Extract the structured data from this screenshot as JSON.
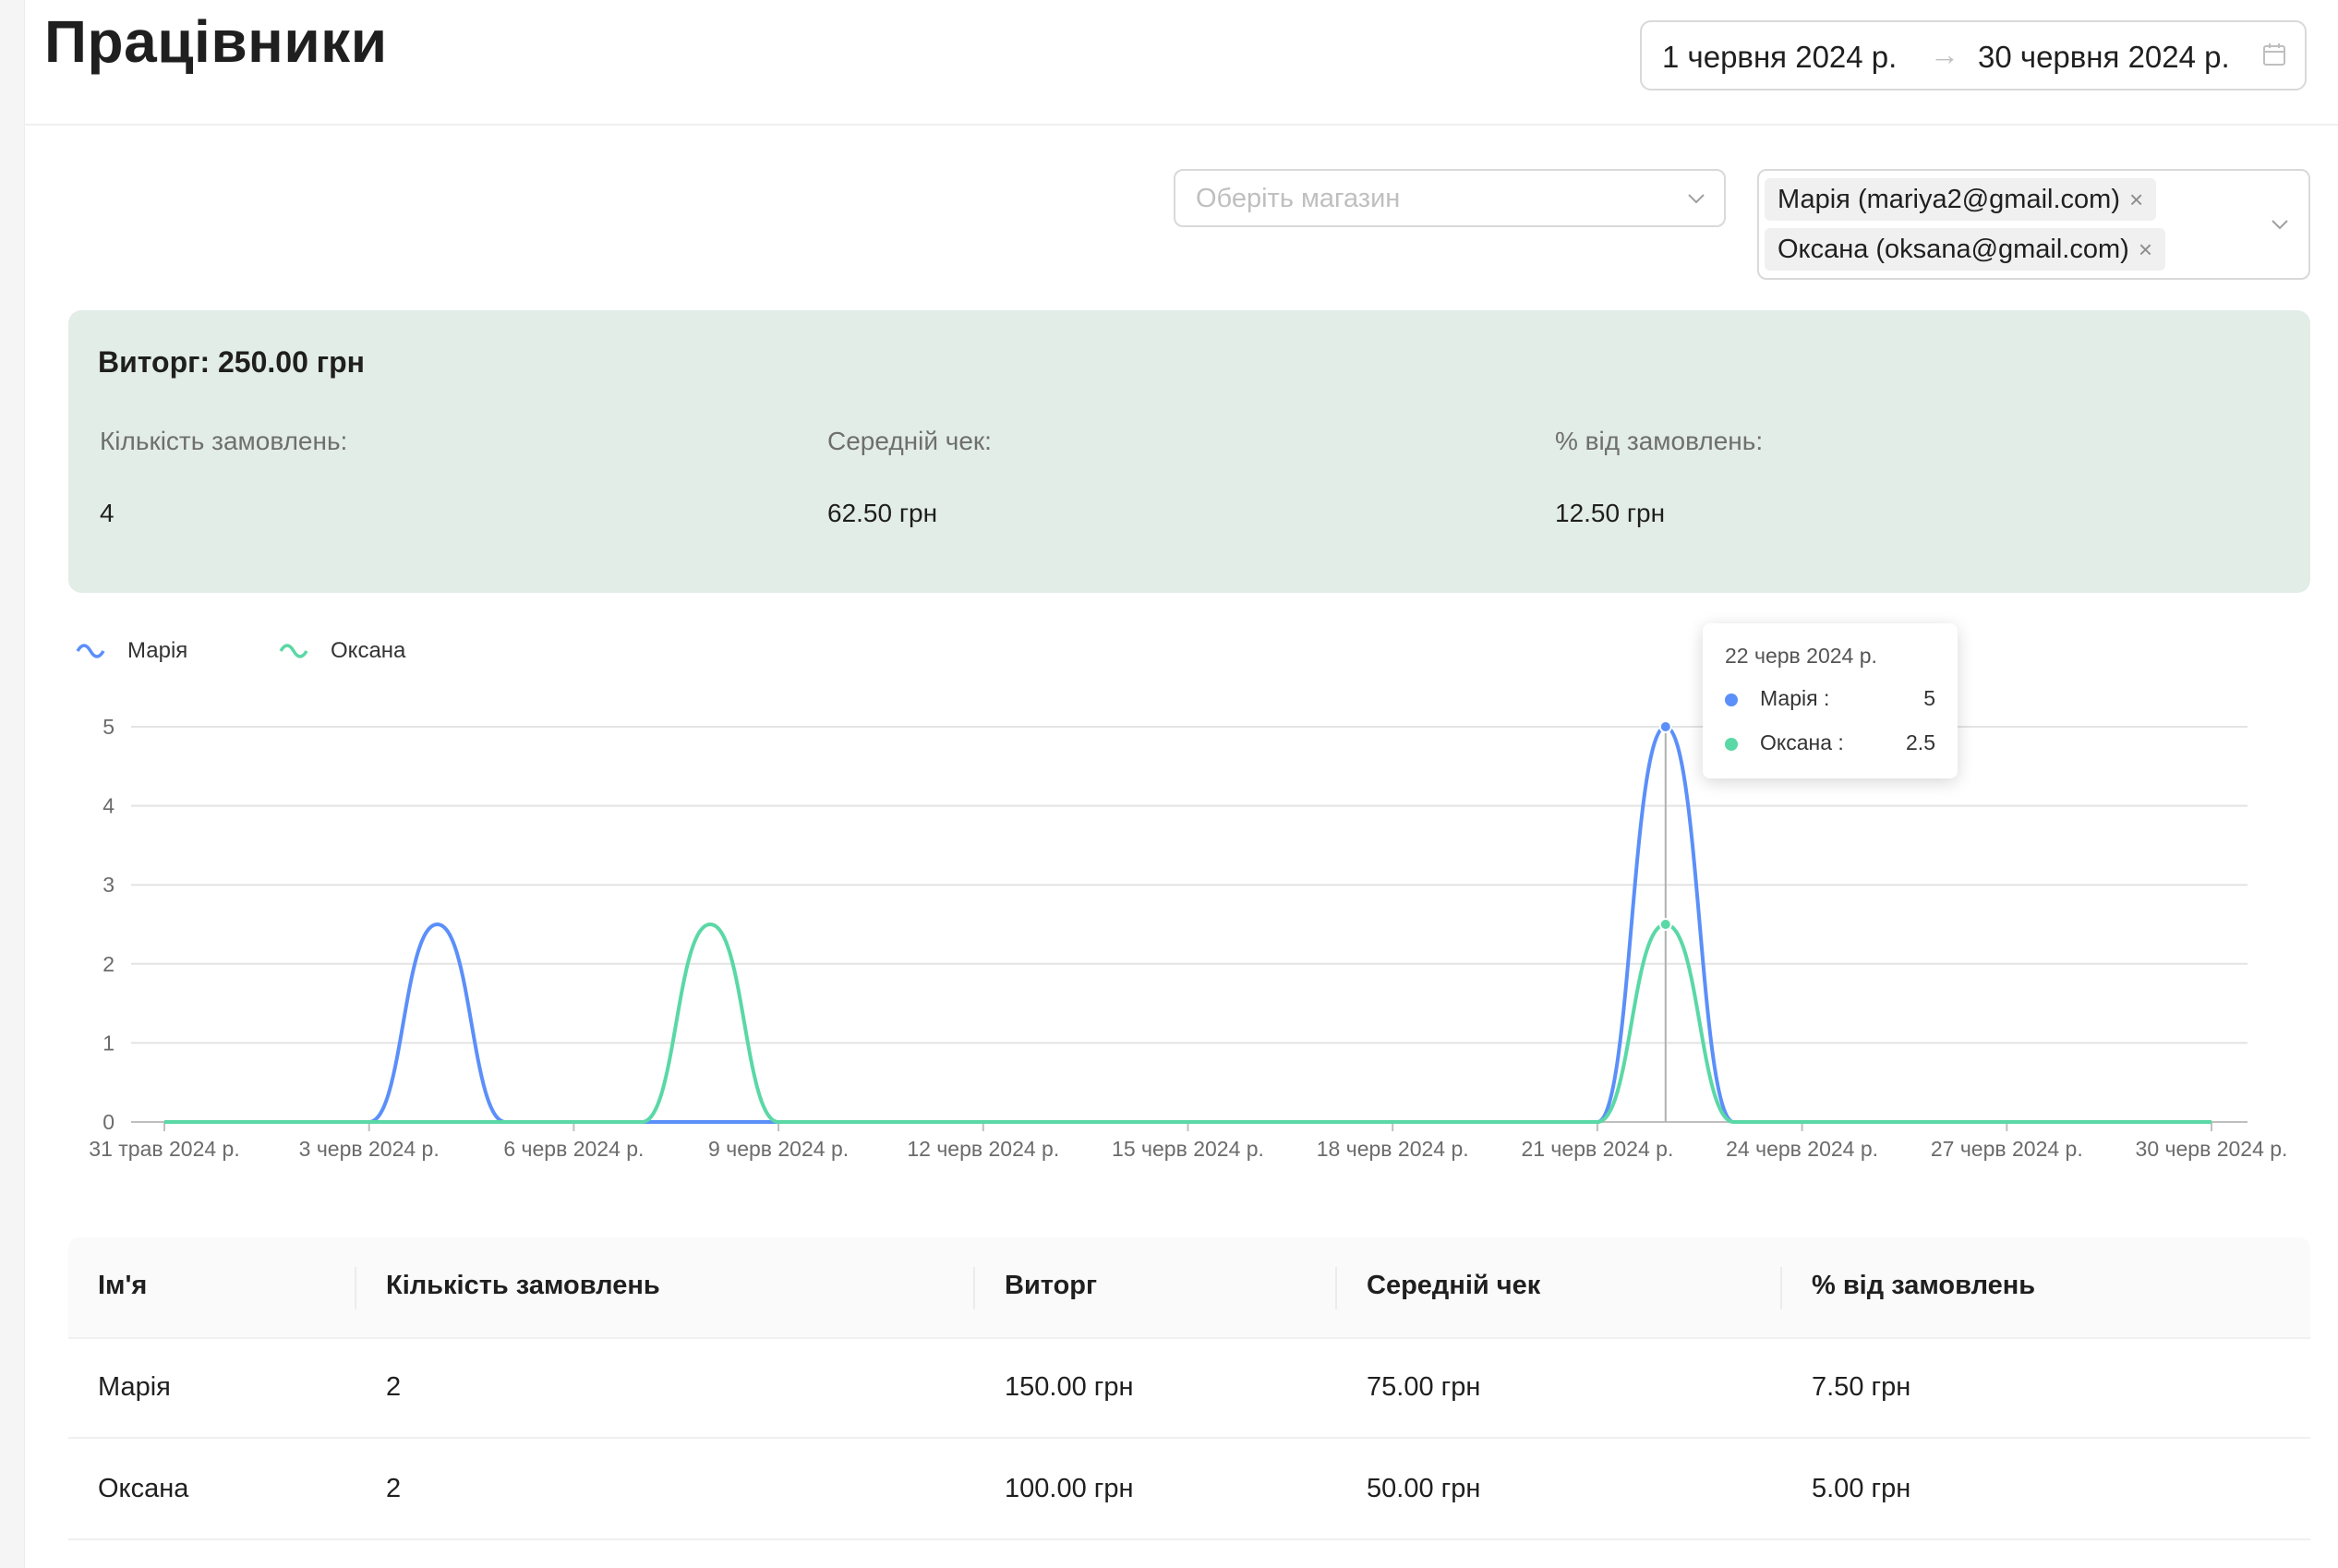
{
  "header": {
    "title": "Працівники",
    "date_range": {
      "start": "1 червня 2024 р.",
      "arrow": "→",
      "end": "30 червня 2024 р."
    }
  },
  "filters": {
    "store_placeholder": "Оберіть магазин",
    "employees": [
      {
        "label": "Марія  (mariya2@gmail.com)"
      },
      {
        "label": "Оксана  (oksana@gmail.com)"
      }
    ],
    "tag_close": "×"
  },
  "summary": {
    "title": "Виторг: 250.00 грн",
    "stats": [
      {
        "label": "Кількість замовлень:",
        "value": "4"
      },
      {
        "label": "Середній чек:",
        "value": "62.50 грн"
      },
      {
        "label": "% від замовлень:",
        "value": "12.50 грн"
      }
    ]
  },
  "colors": {
    "series_maria": "#5b8ff9",
    "series_oksana": "#5ad8a6",
    "summary_bg": "#e3ede7"
  },
  "chart_data": {
    "type": "line",
    "x_dates": [
      "2024-05-31",
      "2024-06-01",
      "2024-06-02",
      "2024-06-03",
      "2024-06-04",
      "2024-06-05",
      "2024-06-06",
      "2024-06-07",
      "2024-06-08",
      "2024-06-09",
      "2024-06-10",
      "2024-06-11",
      "2024-06-12",
      "2024-06-13",
      "2024-06-14",
      "2024-06-15",
      "2024-06-16",
      "2024-06-17",
      "2024-06-18",
      "2024-06-19",
      "2024-06-20",
      "2024-06-21",
      "2024-06-22",
      "2024-06-23",
      "2024-06-24",
      "2024-06-25",
      "2024-06-26",
      "2024-06-27",
      "2024-06-28",
      "2024-06-29",
      "2024-06-30"
    ],
    "x_ticks": [
      "31 трав 2024 р.",
      "3 черв 2024 р.",
      "6 черв 2024 р.",
      "9 черв 2024 р.",
      "12 черв 2024 р.",
      "15 черв 2024 р.",
      "18 черв 2024 р.",
      "21 черв 2024 р.",
      "24 черв 2024 р.",
      "27 черв 2024 р.",
      "30 черв 2024 р."
    ],
    "y_ticks": [
      "0",
      "1",
      "2",
      "3",
      "4",
      "5"
    ],
    "ylim": [
      0,
      5
    ],
    "series": [
      {
        "name": "Марія",
        "values": [
          0,
          0,
          0,
          0,
          2.5,
          0,
          0,
          0,
          0,
          0,
          0,
          0,
          0,
          0,
          0,
          0,
          0,
          0,
          0,
          0,
          0,
          0,
          5,
          0,
          0,
          0,
          0,
          0,
          0,
          0,
          0
        ]
      },
      {
        "name": "Оксана",
        "values": [
          0,
          0,
          0,
          0,
          0,
          0,
          0,
          0,
          2.5,
          0,
          0,
          0,
          0,
          0,
          0,
          0,
          0,
          0,
          0,
          0,
          0,
          0,
          2.5,
          0,
          0,
          0,
          0,
          0,
          0,
          0,
          0
        ]
      }
    ],
    "tooltip": {
      "date": "22 черв 2024 р.",
      "rows": [
        {
          "name": "Марія :",
          "value": "5"
        },
        {
          "name": "Оксана :",
          "value": "2.5"
        }
      ]
    },
    "grid": true,
    "legend": "top-left"
  },
  "table": {
    "columns": [
      "Ім'я",
      "Кількість замовлень",
      "Виторг",
      "Середній чек",
      "% від замовлень"
    ],
    "rows": [
      [
        "Марія",
        "2",
        "150.00 грн",
        "75.00 грн",
        "7.50 грн"
      ],
      [
        "Оксана",
        "2",
        "100.00 грн",
        "50.00 грн",
        "5.00 грн"
      ]
    ]
  }
}
